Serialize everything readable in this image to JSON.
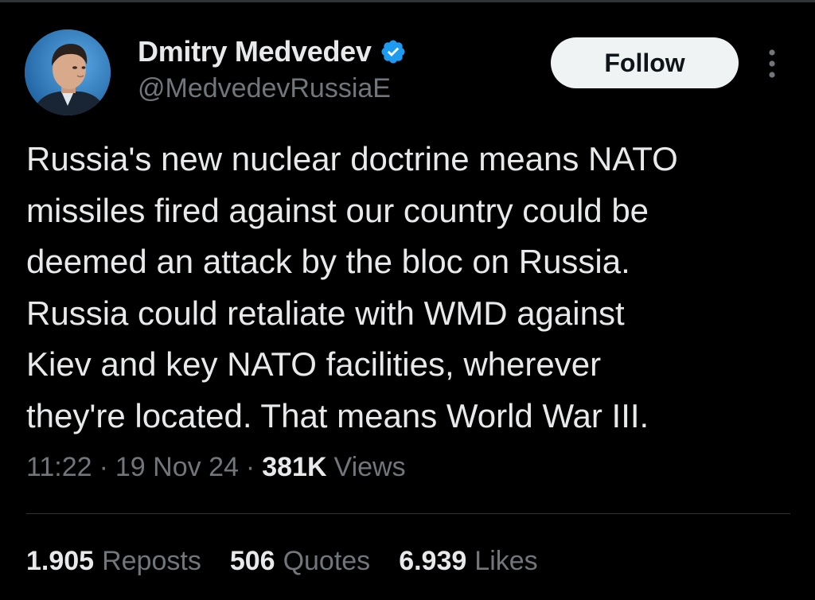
{
  "author": {
    "display_name": "Dmitry Medvedev",
    "handle": "@MedvedevRussiaE",
    "verified_icon": "verified-badge-icon",
    "avatar": "avatar"
  },
  "actions": {
    "follow_label": "Follow",
    "more_icon": "more-vertical-icon"
  },
  "tweet": {
    "text_lines": [
      "Russia's new nuclear doctrine means NATO",
      "missiles fired against our country could be",
      "deemed an attack by the bloc on Russia.",
      "Russia could retaliate with WMD against",
      "Kiev and key NATO facilities, wherever",
      "they're located. That means World War III."
    ],
    "text": "Russia's new nuclear doctrine means NATO\nmissiles fired against our country could be\ndeemed an attack by the bloc on Russia.\nRussia could retaliate with WMD against\nKiev and key NATO facilities, wherever\nthey're located. That means World War III."
  },
  "meta": {
    "time": "11:22",
    "separator": "·",
    "date": "19 Nov 24",
    "views_count": "381K",
    "views_label": "Views"
  },
  "stats": {
    "reposts_count": "1.905",
    "reposts_label": "Reposts",
    "quotes_count": "506",
    "quotes_label": "Quotes",
    "likes_count": "6.939",
    "likes_label": "Likes"
  },
  "colors": {
    "background": "#000000",
    "primary_text": "#e7e9ea",
    "secondary_text": "#71767b",
    "verified_blue": "#1d9bf0",
    "follow_bg": "#eff3f4",
    "divider": "#2f3336"
  }
}
